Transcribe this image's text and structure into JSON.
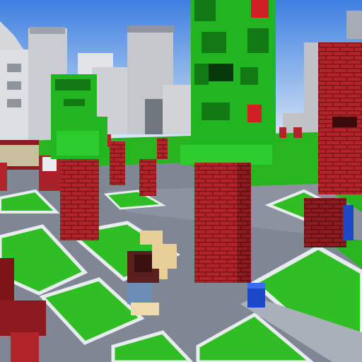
{
  "scene": {
    "description_tag": "voxel-plaza",
    "colors": {
      "sky_top": "#3d7fe0",
      "sky_bottom": "#cfe3f5",
      "grass": "#29b51f",
      "grass_light": "#45d13a",
      "pavement": "#7e8793",
      "pavement_light": "#a9b0ba",
      "curb": "#e8ecef",
      "brick": "#b3232a",
      "brick_dark": "#7c1418",
      "block_green": "#22b522",
      "block_green_dark": "#117a14",
      "block_red": "#d11f26",
      "building": "#d5d7da",
      "building_shadow": "#9da3aa",
      "player_shirt": "#5b1e1e",
      "player_pants": "#6c8db4",
      "player_hair": "#e8cf9a",
      "blue_block": "#1b47c9"
    }
  }
}
